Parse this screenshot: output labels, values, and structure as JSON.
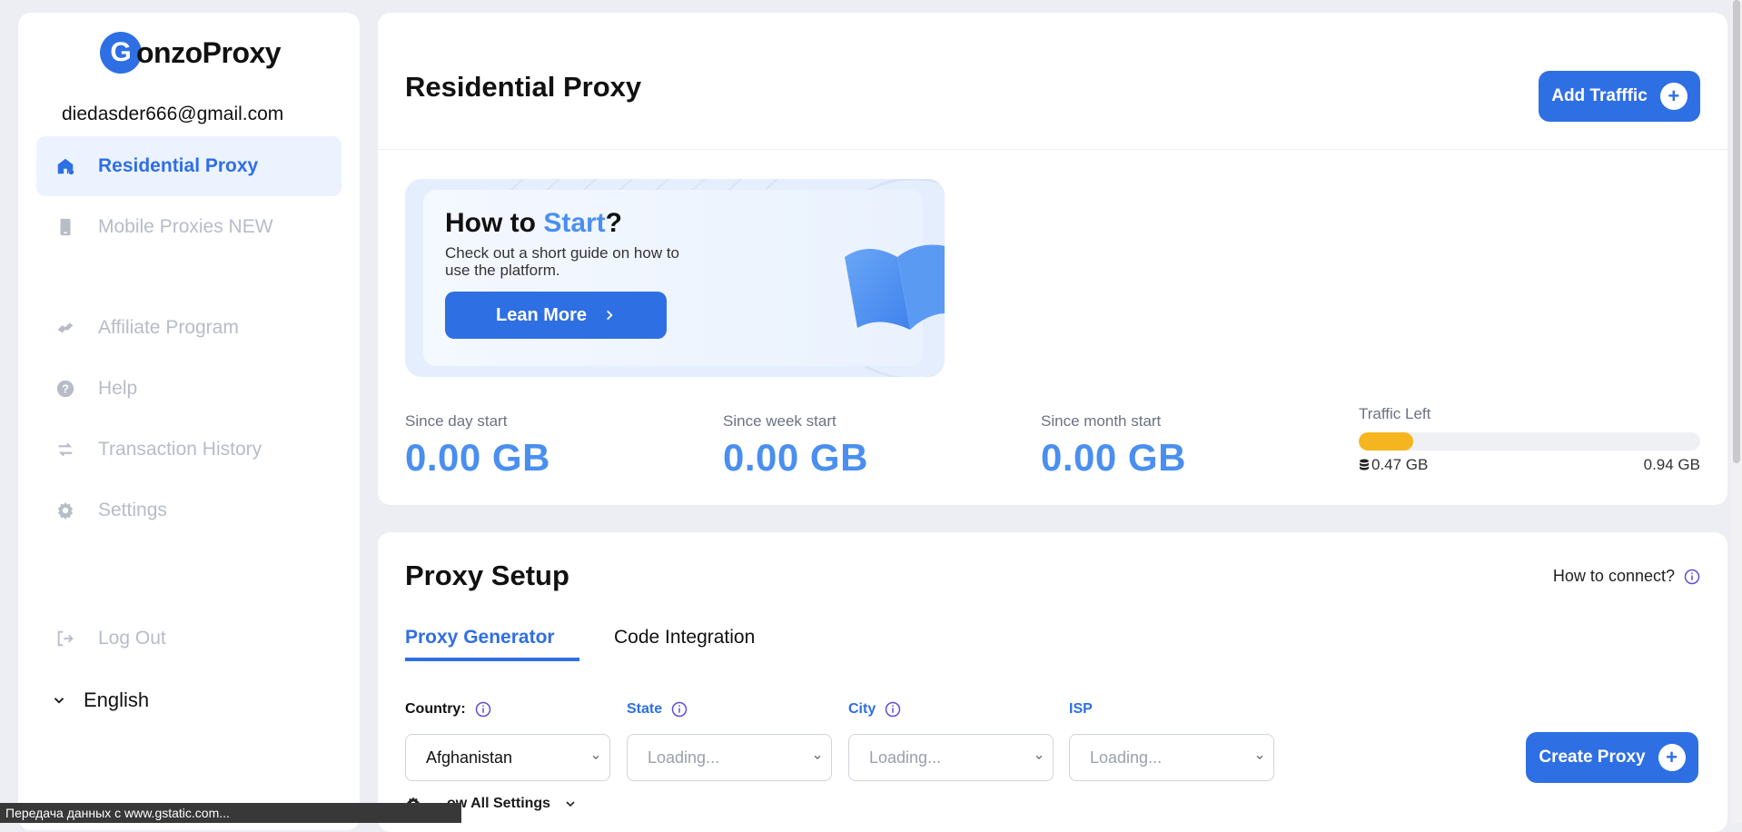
{
  "sidebar": {
    "logo_letter": "G",
    "logo_text": "onzoProxy",
    "email": "diedasder666@gmail.com",
    "items": [
      {
        "label": "Residential Proxy",
        "icon": "home-icon",
        "active": true
      },
      {
        "label": "Mobile Proxies NEW",
        "icon": "phone-icon"
      },
      {
        "label": "Affiliate Program",
        "icon": "handshake-icon"
      },
      {
        "label": "Help",
        "icon": "help-icon"
      },
      {
        "label": "Transaction History",
        "icon": "arrows-icon"
      },
      {
        "label": "Settings",
        "icon": "gear-icon"
      },
      {
        "label": "Log Out",
        "icon": "logout-icon"
      }
    ],
    "language": "English"
  },
  "header": {
    "title": "Residential Proxy",
    "add_traffic_label": "Add Trafffic"
  },
  "banner": {
    "title_prefix": "How to ",
    "title_accent": "Start",
    "title_suffix": "?",
    "subtitle": "Check out a short guide on how to use the platform.",
    "button_label": "Lean More"
  },
  "stats": [
    {
      "label": "Since day start",
      "value": "0.00 GB"
    },
    {
      "label": "Since week start",
      "value": "0.00 GB"
    },
    {
      "label": "Since month start",
      "value": "0.00 GB"
    }
  ],
  "traffic": {
    "label": "Traffic Left",
    "used": "0.47 GB",
    "total": "0.94 GB",
    "bar_fraction": 0.16,
    "bar_color": "#f5b51f"
  },
  "setup": {
    "title": "Proxy Setup",
    "how_to_connect": "How to connect?",
    "tabs": [
      "Proxy Generator",
      "Code Integration"
    ],
    "fields": [
      {
        "label": "Country:",
        "value": "Afghanistan"
      },
      {
        "label": "State",
        "value": "Loading..."
      },
      {
        "label": "City",
        "value": "Loading..."
      },
      {
        "label": "ISP",
        "value": "Loading..."
      }
    ],
    "create_label": "Create Proxy",
    "all_settings_label": "ow All Settings"
  },
  "statusbar": {
    "text": "Передача данных с www.gstatic.com..."
  },
  "colors": {
    "accent": "#2f6fe4",
    "accent_light": "#4a8ff0",
    "muted_nav": "#b7bcc6"
  }
}
